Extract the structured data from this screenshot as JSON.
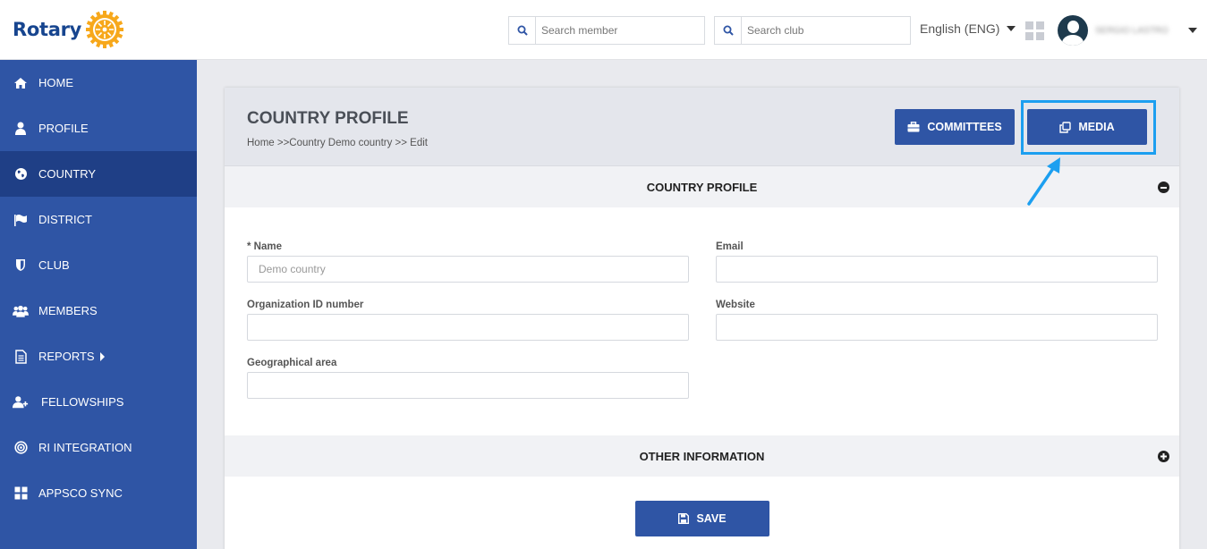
{
  "header": {
    "logo_text": "Rotary",
    "search_member_placeholder": "Search member",
    "search_club_placeholder": "Search club",
    "language": "English (ENG)",
    "username": "SERGIO LASTRO"
  },
  "sidebar": {
    "items": [
      {
        "label": "HOME",
        "icon": "home-icon"
      },
      {
        "label": "PROFILE",
        "icon": "user-icon"
      },
      {
        "label": "COUNTRY",
        "icon": "globe-icon",
        "active": true
      },
      {
        "label": "DISTRICT",
        "icon": "flag-icon"
      },
      {
        "label": "CLUB",
        "icon": "shield-icon"
      },
      {
        "label": "MEMBERS",
        "icon": "users-icon"
      },
      {
        "label": "REPORTS",
        "icon": "file-icon",
        "submenu": true
      },
      {
        "label": "FELLOWSHIPS",
        "icon": "user-plus-icon"
      },
      {
        "label": "RI INTEGRATION",
        "icon": "target-icon"
      },
      {
        "label": "APPSCO SYNC",
        "icon": "grid-icon"
      }
    ]
  },
  "page": {
    "title": "COUNTRY PROFILE",
    "breadcrumb": "Home >>Country Demo country >> Edit",
    "committees_label": "COMMITTEES",
    "media_label": "MEDIA"
  },
  "sections": {
    "profile_title": "COUNTRY PROFILE",
    "other_title": "OTHER INFORMATION"
  },
  "form": {
    "name_label": "* Name",
    "name_placeholder": "Demo country",
    "email_label": "Email",
    "org_id_label": "Organization ID number",
    "website_label": "Website",
    "geo_label": "Geographical area"
  },
  "save_label": "SAVE",
  "colors": {
    "primary": "#2f55a5",
    "sidebar_active": "#1f3f86",
    "highlight": "#1c9ff0",
    "logo": "#17458f",
    "wheel": "#f7a81b"
  }
}
